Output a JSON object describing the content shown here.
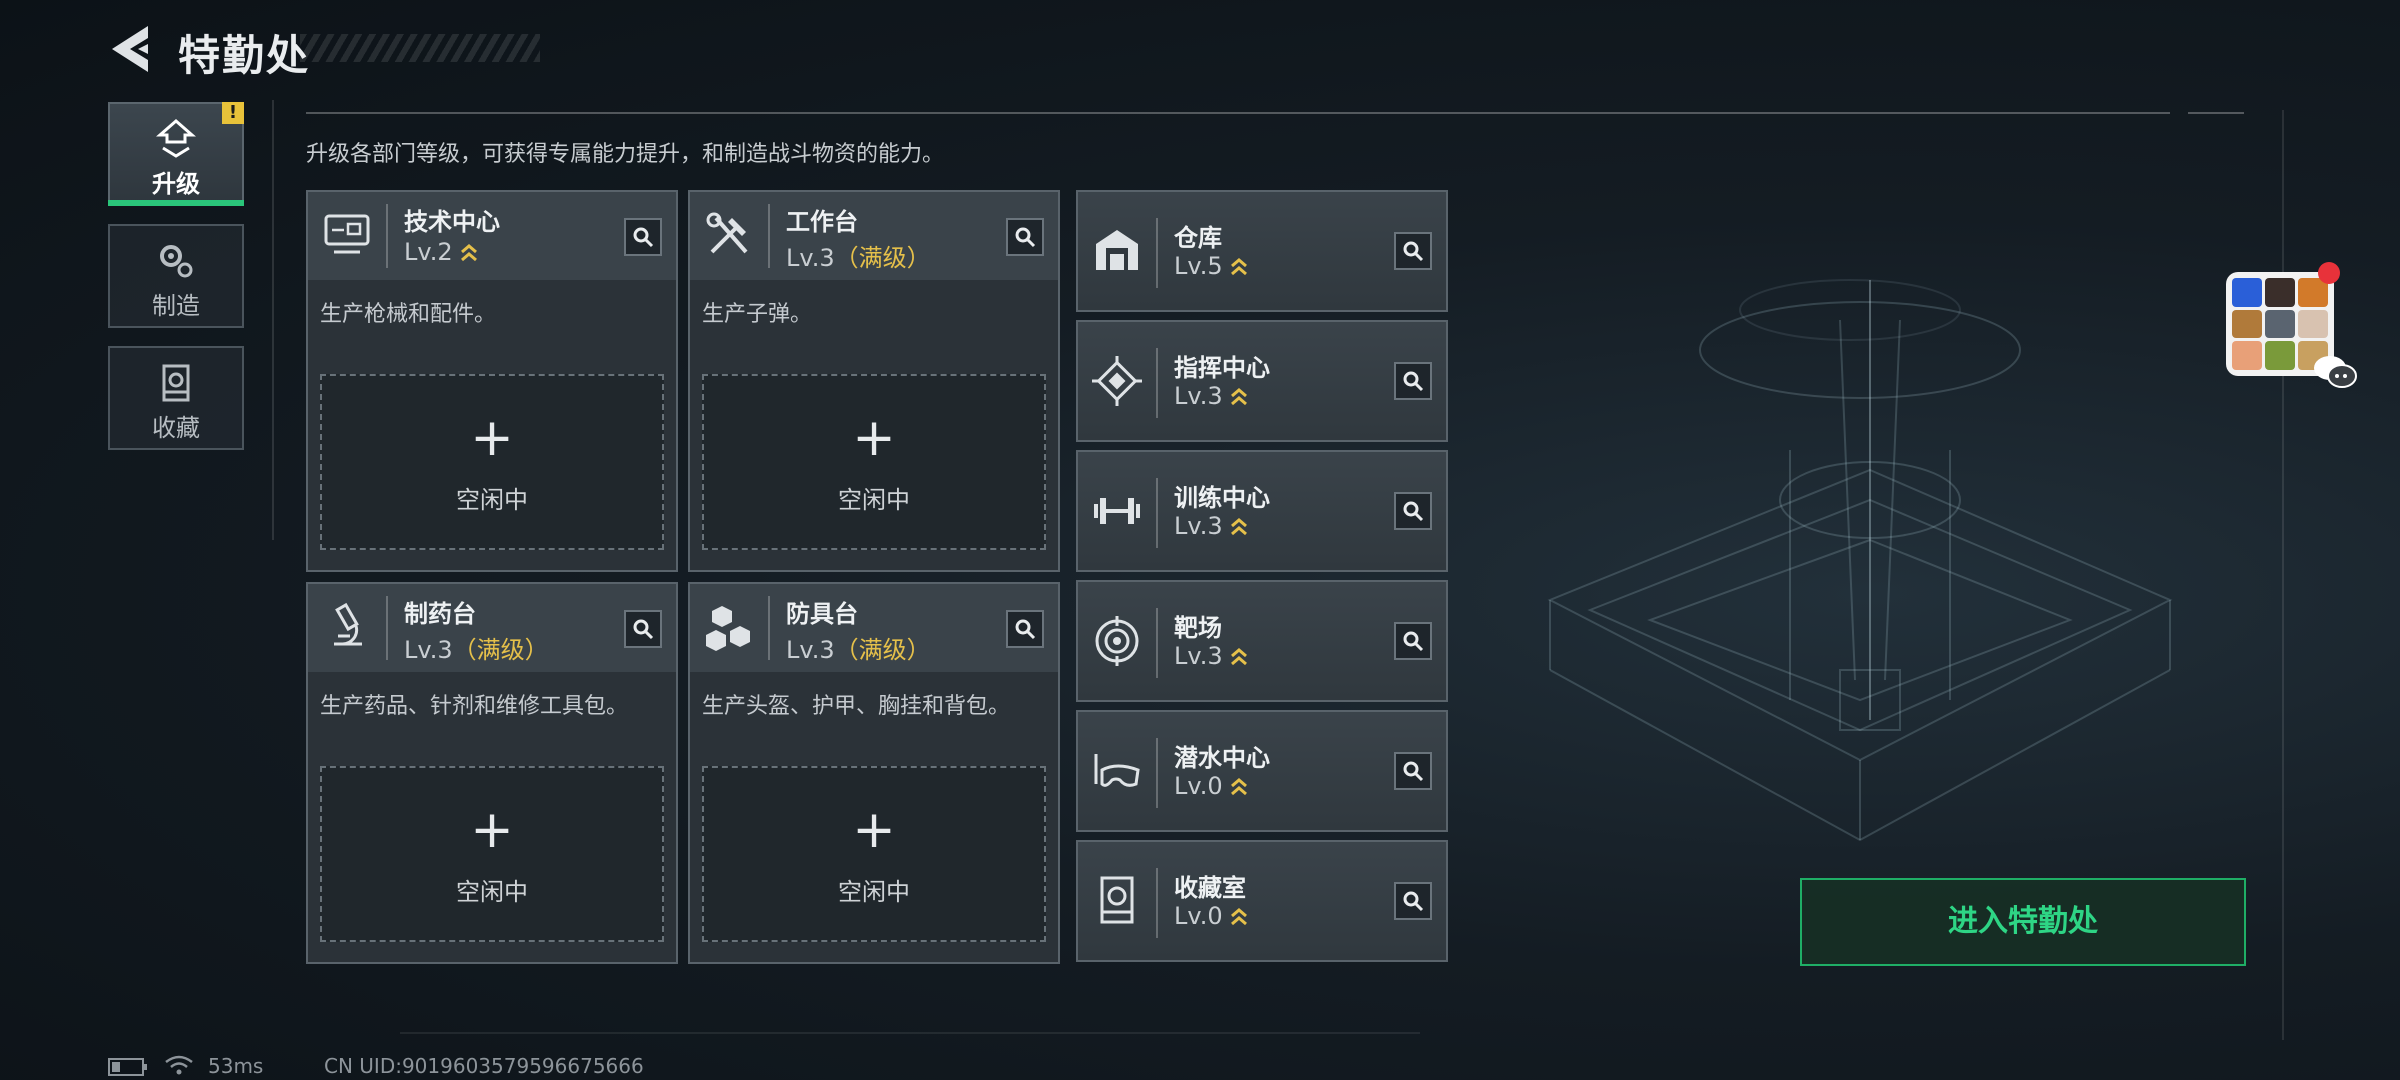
{
  "header": {
    "title": "特勤处"
  },
  "sidebar": {
    "tabs": [
      {
        "label": "升级",
        "active": true,
        "badge": "!"
      },
      {
        "label": "制造",
        "active": false
      },
      {
        "label": "收藏",
        "active": false
      }
    ]
  },
  "main": {
    "description": "升级各部门等级，可获得专属能力提升，和制造战斗物资的能力。",
    "big_cards": [
      {
        "name": "技术中心",
        "level": "Lv.2",
        "maxed": "",
        "desc": "生产枪械和配件。",
        "slot_plus": "+",
        "slot_status": "空闲中",
        "icon": "computer-icon"
      },
      {
        "name": "工作台",
        "level": "Lv.3",
        "maxed": "（满级）",
        "desc": "生产子弹。",
        "slot_plus": "+",
        "slot_status": "空闲中",
        "icon": "tools-icon"
      },
      {
        "name": "制药台",
        "level": "Lv.3",
        "maxed": "（满级）",
        "desc": "生产药品、针剂和维修工具包。",
        "slot_plus": "+",
        "slot_status": "空闲中",
        "icon": "microscope-icon"
      },
      {
        "name": "防具台",
        "level": "Lv.3",
        "maxed": "（满级）",
        "desc": "生产头盔、护甲、胸挂和背包。",
        "slot_plus": "+",
        "slot_status": "空闲中",
        "icon": "armor-boxes-icon"
      }
    ],
    "small_cards": [
      {
        "name": "仓库",
        "level": "Lv.5",
        "icon": "warehouse-icon"
      },
      {
        "name": "指挥中心",
        "level": "Lv.3",
        "icon": "command-chip-icon"
      },
      {
        "name": "训练中心",
        "level": "Lv.3",
        "icon": "dumbbell-icon"
      },
      {
        "name": "靶场",
        "level": "Lv.3",
        "icon": "target-icon"
      },
      {
        "name": "潜水中心",
        "level": "Lv.0",
        "icon": "diving-mask-icon"
      },
      {
        "name": "收藏室",
        "level": "Lv.0",
        "icon": "trophy-case-icon"
      }
    ]
  },
  "actions": {
    "enter_label": "进入特勤处"
  },
  "footer": {
    "ping": "53ms",
    "uid": "CN UID:9019603579596675666"
  },
  "colors": {
    "accent_green": "#2ed585",
    "maxed_yellow": "#e5c04a",
    "warn_yellow": "#e8c23a",
    "notify_red": "#e8323a"
  }
}
